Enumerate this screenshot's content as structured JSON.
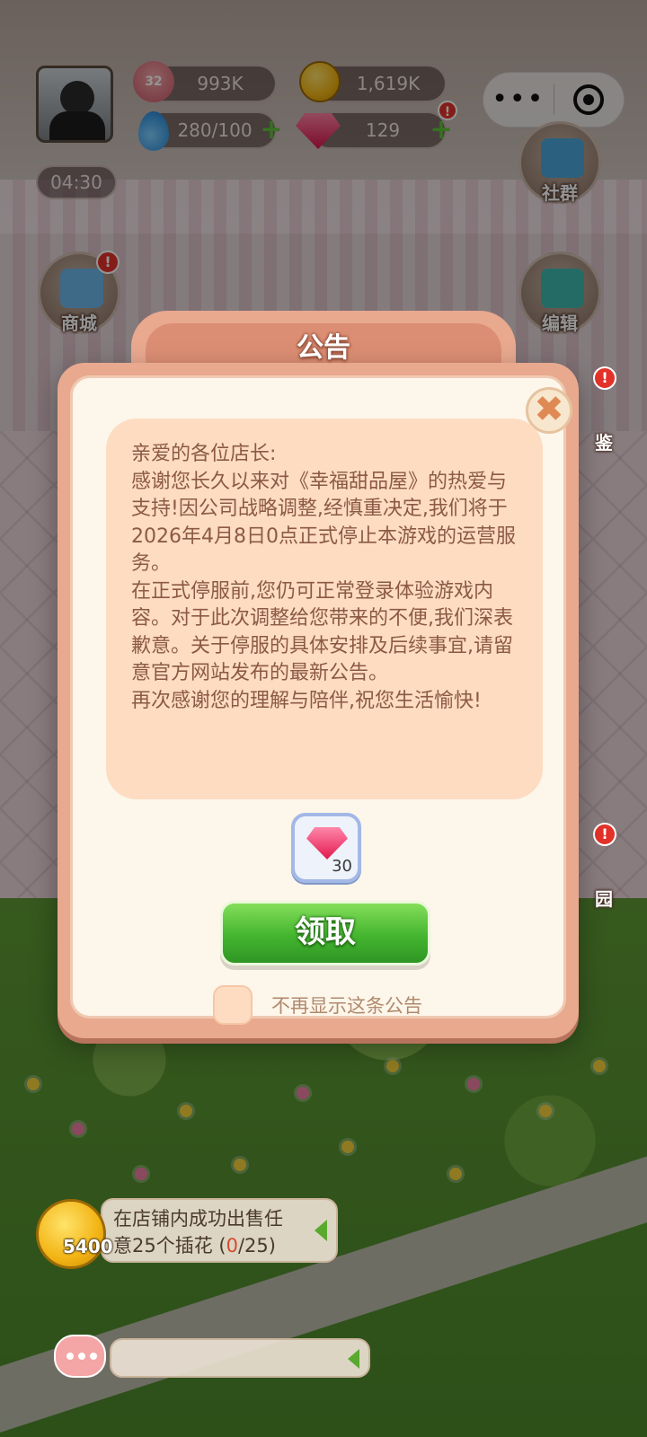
{
  "hud": {
    "level": "32",
    "exp": "993K",
    "coins": "1,619K",
    "energy": "280/100",
    "gems": "129",
    "timer": "04:30"
  },
  "capsule": {
    "more_icon": "more-dots-icon",
    "close_icon": "target-circle-icon"
  },
  "side_buttons": {
    "shop": "商城",
    "community": "社群",
    "edit": "编辑",
    "collection_partial": "鉴",
    "garden_partial": "园"
  },
  "modal": {
    "title": "公告",
    "close_glyph": "✖",
    "notice": {
      "greeting": "亲爱的各位店长:",
      "p1": "感谢您长久以来对《幸福甜品屋》的热爱与支持!因公司战略调整,经慎重决定,我们将于2026年4月8日0点正式停止本游戏的运营服务。",
      "p2": "在正式停服前,您仍可正常登录体验游戏内容。对于此次调整给您带来的不便,我们深表歉意。关于停服的具体安排及后续事宜,请留意官方网站发布的最新公告。",
      "p3": "再次感谢您的理解与陪伴,祝您生活愉快!"
    },
    "reward": {
      "icon": "gem-icon",
      "quantity": "30"
    },
    "claim_label": "领取",
    "dont_show_label": "不再显示这条公告",
    "dont_show_checked": false
  },
  "task": {
    "reward": "5400",
    "line1": "在店铺内成功出售任",
    "line2_prefix": "意25个插花 (",
    "progress": "0",
    "line2_suffix": "/25)"
  },
  "colors": {
    "modal_frame": "#e8a98f",
    "notice_bg": "#fddcc2",
    "notice_text": "#8c5a44",
    "claim_green": "#44b52f"
  }
}
